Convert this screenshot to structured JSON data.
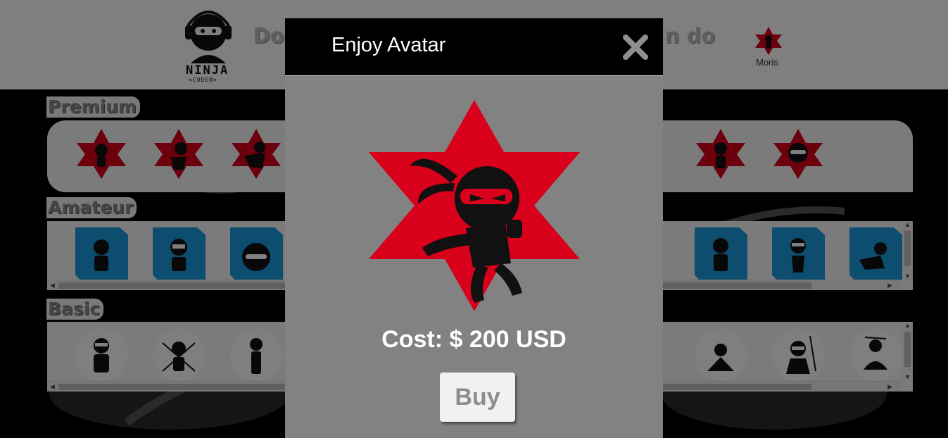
{
  "header": {
    "logo_text": "NINJA",
    "logo_subtext": "<CODER>",
    "title_left": "Do",
    "title_right": "n do",
    "user_name": "Moris"
  },
  "sections": {
    "premium": {
      "title": "Premium",
      "items": [
        "ninja-star",
        "ninja-star",
        "ninja-star",
        "ninja-star",
        "ninja-star",
        "ninja-star"
      ]
    },
    "amateur": {
      "title": "Amateur",
      "items": [
        "ninja-badge",
        "ninja-badge",
        "ninja-badge",
        "ninja-badge",
        "ninja-badge",
        "ninja-badge",
        "ninja-badge"
      ]
    },
    "basic": {
      "title": "Basic",
      "items": [
        "ninja-circle",
        "ninja-circle",
        "ninja-circle",
        "ninja-circle",
        "ninja-circle",
        "ninja-circle",
        "ninja-circle"
      ]
    }
  },
  "modal": {
    "title": "Enjoy Avatar",
    "close_icon": "close-x-icon",
    "avatar_icon": "red-star-ninja-icon",
    "cost_label": "Cost: $ 200 USD",
    "buy_label": "Buy"
  },
  "colors": {
    "accent_red": "#d9001b",
    "amateur_blue": "#1b9be0",
    "modal_bg": "#828282",
    "modal_header": "#000000"
  }
}
